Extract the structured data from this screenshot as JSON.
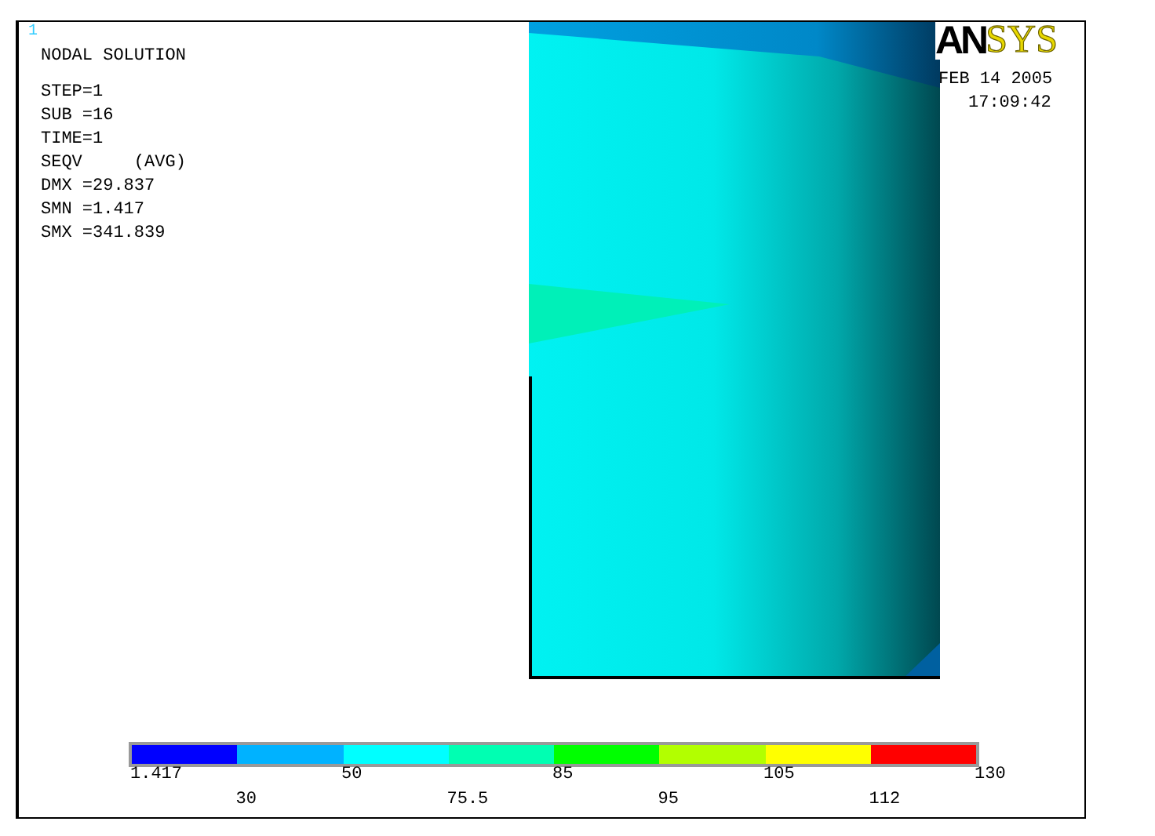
{
  "window_number": "1",
  "info_lines": [
    "NODAL SOLUTION",
    "STEP=1",
    "SUB =16",
    "TIME=1",
    "SEQV     (AVG)",
    "DMX =29.837",
    "SMN =1.417",
    "SMX =341.839"
  ],
  "logo": {
    "part_1": "AN",
    "part_2": "SYS"
  },
  "date": "FEB 14 2005",
  "time": "17:09:42",
  "legend": {
    "bands": [
      {
        "color": "#0000ff"
      },
      {
        "color": "#00b2ff"
      },
      {
        "color": "#00ffff"
      },
      {
        "color": "#00ffb2"
      },
      {
        "color": "#00ff00"
      },
      {
        "color": "#b2ff00"
      },
      {
        "color": "#ffff00"
      },
      {
        "color": "#ff0000"
      }
    ],
    "ticks": [
      "1.417",
      "30",
      "50",
      "75.5",
      "85",
      "95",
      "105",
      "112",
      "130"
    ]
  }
}
